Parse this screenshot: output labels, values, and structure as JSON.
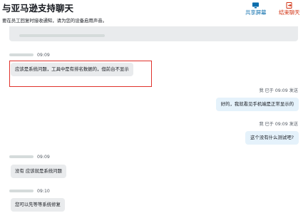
{
  "header": {
    "title": "与亚马逊支持聊天",
    "subtitle": "要在员工回复时接收通知，请为您的设备启用声音。",
    "share_label": "共享屏幕",
    "end_label": "结束聊天",
    "share_icon": "monitor-icon",
    "end_icon": "exit-icon"
  },
  "messages": [
    {
      "time": "09:09",
      "text": "应该是系统问题，工具中是有排名数据的，但前台不显示"
    },
    {
      "meta": "我  已于 09:09 发送",
      "text": "好的，我就看见手机端是正常显示的"
    },
    {
      "meta": "我  已于 09:09 发送",
      "text": "这个没有什么测试吧?"
    },
    {
      "time": "09:09",
      "text": "没有 应该就是系统问题"
    },
    {
      "time": "09:10",
      "text": "您可以先等等系统修复"
    }
  ],
  "colors": {
    "accent": "#0b6dac",
    "danger": "#d13212",
    "highlight_border": "#e0322c",
    "bubble_agent": "#e9ebed",
    "bubble_me": "#e5f2fb"
  }
}
